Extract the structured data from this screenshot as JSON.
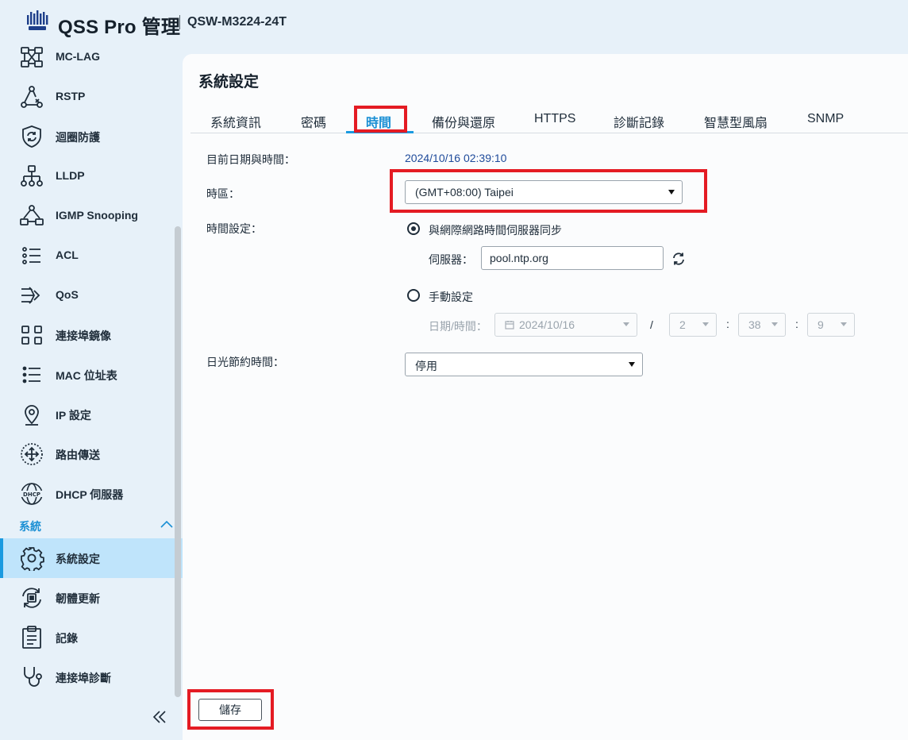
{
  "header": {
    "app_title": "QSS Pro 管理",
    "model": "QSW-M3224-24T"
  },
  "sidebar": {
    "items": [
      {
        "label": "MC-LAG",
        "icon": "mclag-icon"
      },
      {
        "label": "RSTP",
        "icon": "rstp-icon"
      },
      {
        "label": "迴圈防護",
        "icon": "loop-protection-shield-icon"
      },
      {
        "label": "LLDP",
        "icon": "lldp-icon"
      },
      {
        "label": "IGMP  Snooping",
        "icon": "igmp-snooping-icon"
      },
      {
        "label": "ACL",
        "icon": "acl-list-icon"
      },
      {
        "label": "QoS",
        "icon": "qos-icon"
      },
      {
        "label": "連接埠鏡像",
        "icon": "port-mirroring-icon"
      },
      {
        "label": "MAC  位址表",
        "icon": "mac-table-list-icon"
      },
      {
        "label": "IP  設定",
        "icon": "location-pin-icon"
      },
      {
        "label": "路由傳送",
        "icon": "routing-icon"
      },
      {
        "label": "DHCP  伺服器",
        "icon": "dhcp-globe-icon"
      }
    ],
    "section_label": "系統",
    "system_items": [
      {
        "label": "系統設定",
        "icon": "gear-icon",
        "active": true
      },
      {
        "label": "韌體更新",
        "icon": "firmware-update-icon"
      },
      {
        "label": "記錄",
        "icon": "clipboard-icon"
      },
      {
        "label": "連接埠診斷",
        "icon": "stethoscope-icon"
      }
    ]
  },
  "main": {
    "title": "系統設定",
    "tabs": [
      "系統資訊",
      "密碼",
      "時間",
      "備份與還原",
      "HTTPS",
      "診斷記錄",
      "智慧型風扇",
      "SNMP"
    ],
    "active_tab": "時間",
    "form": {
      "current_datetime_label": "目前日期與時間：",
      "current_datetime_value": "2024/10/16 02:39:10",
      "timezone_label": "時區：",
      "timezone_value": "(GMT+08:00) Taipei",
      "time_setting_label": "時間設定：",
      "sync_option_label": "與網際網路時間伺服器同步",
      "server_label": "伺服器：",
      "server_value": "pool.ntp.org",
      "manual_option_label": "手動設定",
      "datetime_label": "日期/時間：",
      "date_value": "2024/10/16",
      "date_sep": "/",
      "hour_value": "2",
      "minute_value": "38",
      "second_value": "9",
      "time_sep": ":",
      "dst_label": "日光節約時間：",
      "dst_value": "停用",
      "sync_selected": true
    },
    "save_label": "儲存"
  },
  "colors": {
    "accent": "#1a9ae0",
    "highlight_box": "#e41b23",
    "active_row": "#bfe4fb",
    "time_value": "#1e4a9a"
  }
}
